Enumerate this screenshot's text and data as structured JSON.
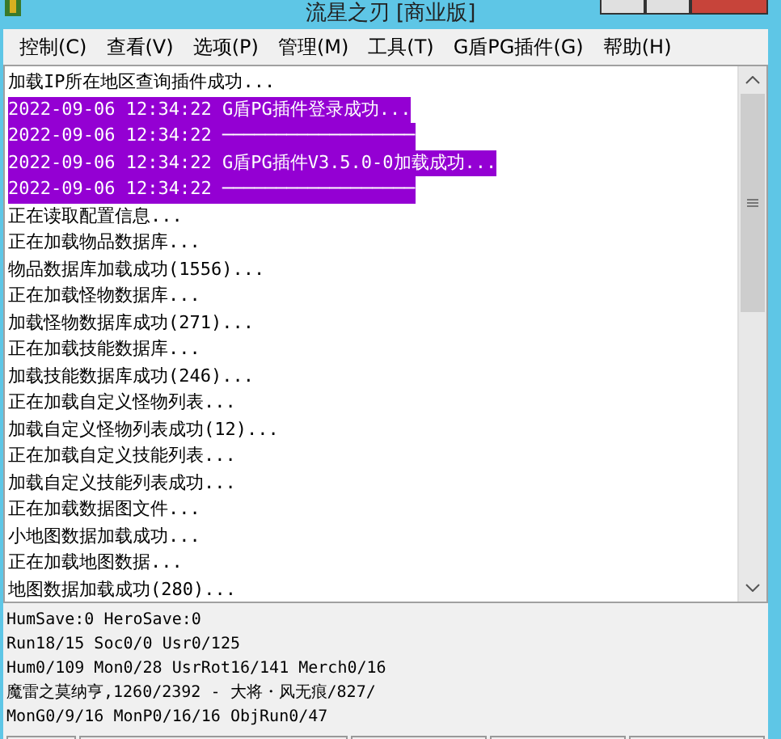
{
  "window": {
    "title": "流星之刃 [商业版]"
  },
  "menu": [
    {
      "label": "控制(C)"
    },
    {
      "label": "查看(V)"
    },
    {
      "label": "选项(P)"
    },
    {
      "label": "管理(M)"
    },
    {
      "label": "工具(T)"
    },
    {
      "label": "G盾PG插件(G)"
    },
    {
      "label": "帮助(H)"
    }
  ],
  "log": [
    {
      "text": "加载IP所在地区查询插件成功...",
      "selected": false
    },
    {
      "text": "2022-09-06 12:34:22 G盾PG插件登录成功...",
      "selected": true
    },
    {
      "text": "2022-09-06 12:34:22 ──────────────────",
      "selected": true
    },
    {
      "text": "2022-09-06 12:34:22 G盾PG插件V3.5.0-0加载成功...",
      "selected": true
    },
    {
      "text": "2022-09-06 12:34:22 ──────────────────",
      "selected": true
    },
    {
      "text": "正在读取配置信息...",
      "selected": false
    },
    {
      "text": "正在加载物品数据库...",
      "selected": false
    },
    {
      "text": "物品数据库加载成功(1556)...",
      "selected": false
    },
    {
      "text": "正在加载怪物数据库...",
      "selected": false
    },
    {
      "text": "加载怪物数据库成功(271)...",
      "selected": false
    },
    {
      "text": "正在加载技能数据库...",
      "selected": false
    },
    {
      "text": "加载技能数据库成功(246)...",
      "selected": false
    },
    {
      "text": "正在加载自定义怪物列表...",
      "selected": false
    },
    {
      "text": "加载自定义怪物列表成功(12)...",
      "selected": false
    },
    {
      "text": "正在加载自定义技能列表...",
      "selected": false
    },
    {
      "text": "加载自定义技能列表成功...",
      "selected": false
    },
    {
      "text": "正在加载数据图文件...",
      "selected": false
    },
    {
      "text": "小地图数据加载成功...",
      "selected": false
    },
    {
      "text": "正在加载地图数据...",
      "selected": false
    },
    {
      "text": "地图数据加载成功(280)...",
      "selected": false
    }
  ],
  "status_lines": [
    {
      "text": "HumSave:0 HeroSave:0"
    },
    {
      "text": "Run18/15 Soc0/0 Usr0/125"
    },
    {
      "text": "Hum0/109 Mon0/28 UsrRot16/141 Merch0/16"
    },
    {
      "text": "魔雷之莫纳亨,1260/2392 - 大将・风无痕/827/"
    },
    {
      "text": "MonG0/9/16 MonP0/16/16 ObjRun0/47"
    }
  ]
}
